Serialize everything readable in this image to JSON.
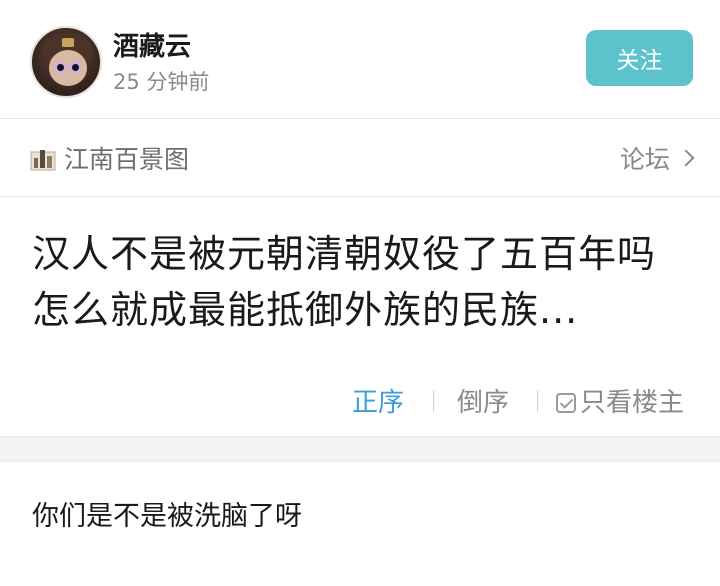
{
  "post_header": {
    "username": "酒藏云",
    "time": "25 分钟前",
    "follow_label": "关注"
  },
  "forum": {
    "name": "江南百景图",
    "link_label": "论坛"
  },
  "thread": {
    "title": "汉人不是被元朝清朝奴役了五百年吗怎么就成最能抵御外族的民族..."
  },
  "sort": {
    "ascending": "正序",
    "descending": "倒序",
    "owner_only": "只看楼主",
    "active_color": "#3a9bd9"
  },
  "reply": {
    "text": "你们是不是被洗脑了呀"
  }
}
